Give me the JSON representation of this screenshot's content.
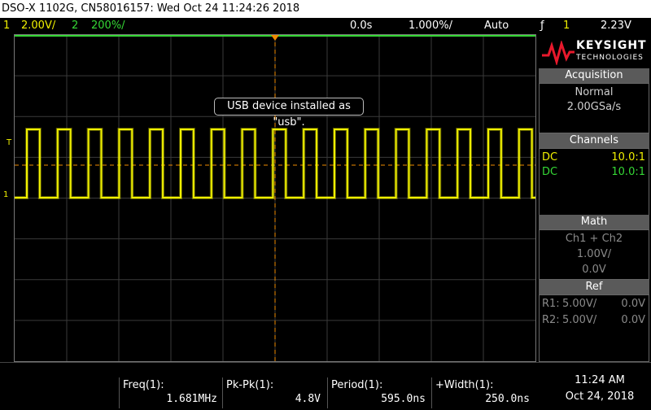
{
  "title_bar": "DSO-X 1102G, CN58016157: Wed Oct 24 11:24:26 2018",
  "status": {
    "ch1_num": "1",
    "ch1_scale": "2.00V/",
    "ch2_num": "2",
    "ch2_scale": "200%/",
    "time_pos": "0.0s",
    "time_scale": "1.000%/",
    "trigger_mode": "Auto",
    "trigger_symbol": "ƒ",
    "trigger_ch": "1",
    "trigger_level": "2.23V"
  },
  "toast": "USB device installed as \"usb\".",
  "logo": {
    "brand": "KEYSIGHT",
    "sub": "TECHNOLOGIES"
  },
  "acquisition": {
    "title": "Acquisition",
    "mode": "Normal",
    "rate": "2.00GSa/s"
  },
  "channels": {
    "title": "Channels",
    "rows": [
      {
        "coupling": "DC",
        "probe": "10.0:1",
        "color": "#f0f000"
      },
      {
        "coupling": "DC",
        "probe": "10.0:1",
        "color": "#35d835"
      }
    ]
  },
  "math": {
    "title": "Math",
    "function": "Ch1 + Ch2",
    "scale": "1.00V/",
    "offset": "0.0V"
  },
  "ref": {
    "title": "Ref",
    "r1_label": "R1:",
    "r1_scale": "5.00V/",
    "r1_offset": "0.0V",
    "r2_label": "R2:",
    "r2_scale": "5.00V/",
    "r2_offset": "0.0V"
  },
  "measurements": [
    {
      "label": "Freq(1):",
      "value": "1.681MHz"
    },
    {
      "label": "Pk-Pk(1):",
      "value": "4.8V"
    },
    {
      "label": "Period(1):",
      "value": "595.0ns"
    },
    {
      "label": "+Width(1):",
      "value": "250.0ns"
    }
  ],
  "clock": {
    "time": "11:24 AM",
    "date": "Oct 24, 2018"
  },
  "marker": {
    "trigger_level": "T",
    "ch1_ground": "1"
  },
  "colors": {
    "ch1": "#f0f000",
    "ch2": "#35d835",
    "trigger": "#f08c00",
    "accent": "#e8192c"
  }
}
